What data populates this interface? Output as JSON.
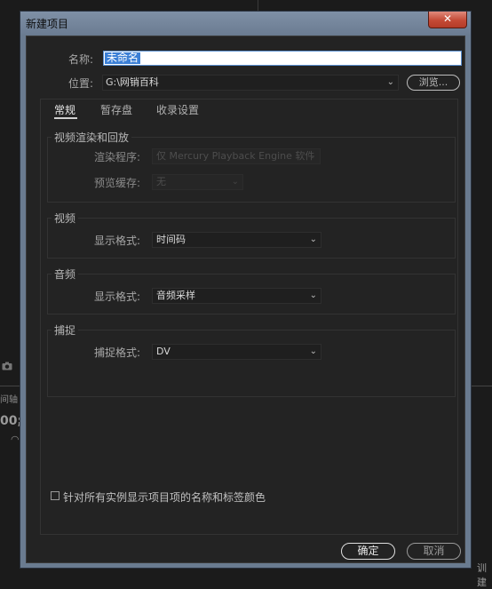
{
  "background": {
    "left_label": "间轴",
    "left_value": "00;",
    "right_label": "训建"
  },
  "dialog": {
    "title": "新建项目",
    "close_glyph": "✕",
    "name_label": "名称:",
    "name_value": "未命名",
    "location_label": "位置:",
    "location_value": "G:\\网销百科",
    "browse_label": "浏览...",
    "tabs": [
      {
        "label": "常规",
        "active": true
      },
      {
        "label": "暂存盘",
        "active": false
      },
      {
        "label": "收录设置",
        "active": false
      }
    ],
    "groups": {
      "render": {
        "title": "视频渲染和回放",
        "renderer_label": "渲染程序:",
        "renderer_value": "仅 Mercury Playback Engine 软件",
        "preview_cache_label": "预览缓存:",
        "preview_cache_value": "无"
      },
      "video": {
        "title": "视频",
        "display_format_label": "显示格式:",
        "display_format_value": "时间码"
      },
      "audio": {
        "title": "音频",
        "display_format_label": "显示格式:",
        "display_format_value": "音频采样"
      },
      "capture": {
        "title": "捕捉",
        "capture_format_label": "捕捉格式:",
        "capture_format_value": "DV"
      }
    },
    "checkbox_label": "针对所有实例显示项目项的名称和标签颜色",
    "checkbox_checked": false,
    "ok_label": "确定",
    "cancel_label": "取消"
  }
}
